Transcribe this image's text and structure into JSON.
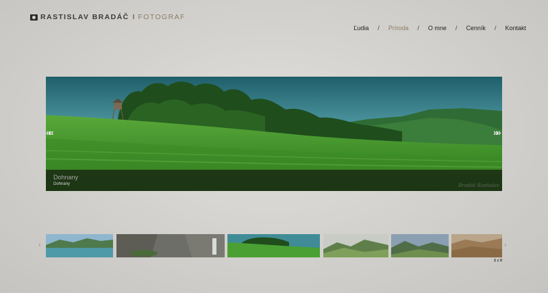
{
  "brand": {
    "name": "RASTISLAV BRADÁČ",
    "separator": "I",
    "role": "FOTOGRAF"
  },
  "nav": {
    "items": [
      {
        "label": "Ľudia",
        "active": false
      },
      {
        "label": "Príroda",
        "active": true
      },
      {
        "label": "O mne",
        "active": false
      },
      {
        "label": "Cenník",
        "active": false
      },
      {
        "label": "Kontakt",
        "active": false
      }
    ],
    "separator": "/"
  },
  "slideshow": {
    "prev_label": "««",
    "next_label": "»»",
    "caption_title": "Dohnany",
    "caption_subtitle": "Dohnany",
    "watermark": "Bradáč Rastislav"
  },
  "thumbnails": {
    "prev_label": "‹",
    "next_label": "›",
    "counter": "2 z 9",
    "items": [
      {
        "name": "lake-landscape"
      },
      {
        "name": "waterfall-rocks"
      },
      {
        "name": "dohnany-meadow",
        "active": true
      },
      {
        "name": "green-hills"
      },
      {
        "name": "mountain-valley"
      },
      {
        "name": "autumn-hills"
      }
    ]
  },
  "colors": {
    "accent": "#8a7b68",
    "background": "#d4d2ce",
    "text": "#222222"
  }
}
